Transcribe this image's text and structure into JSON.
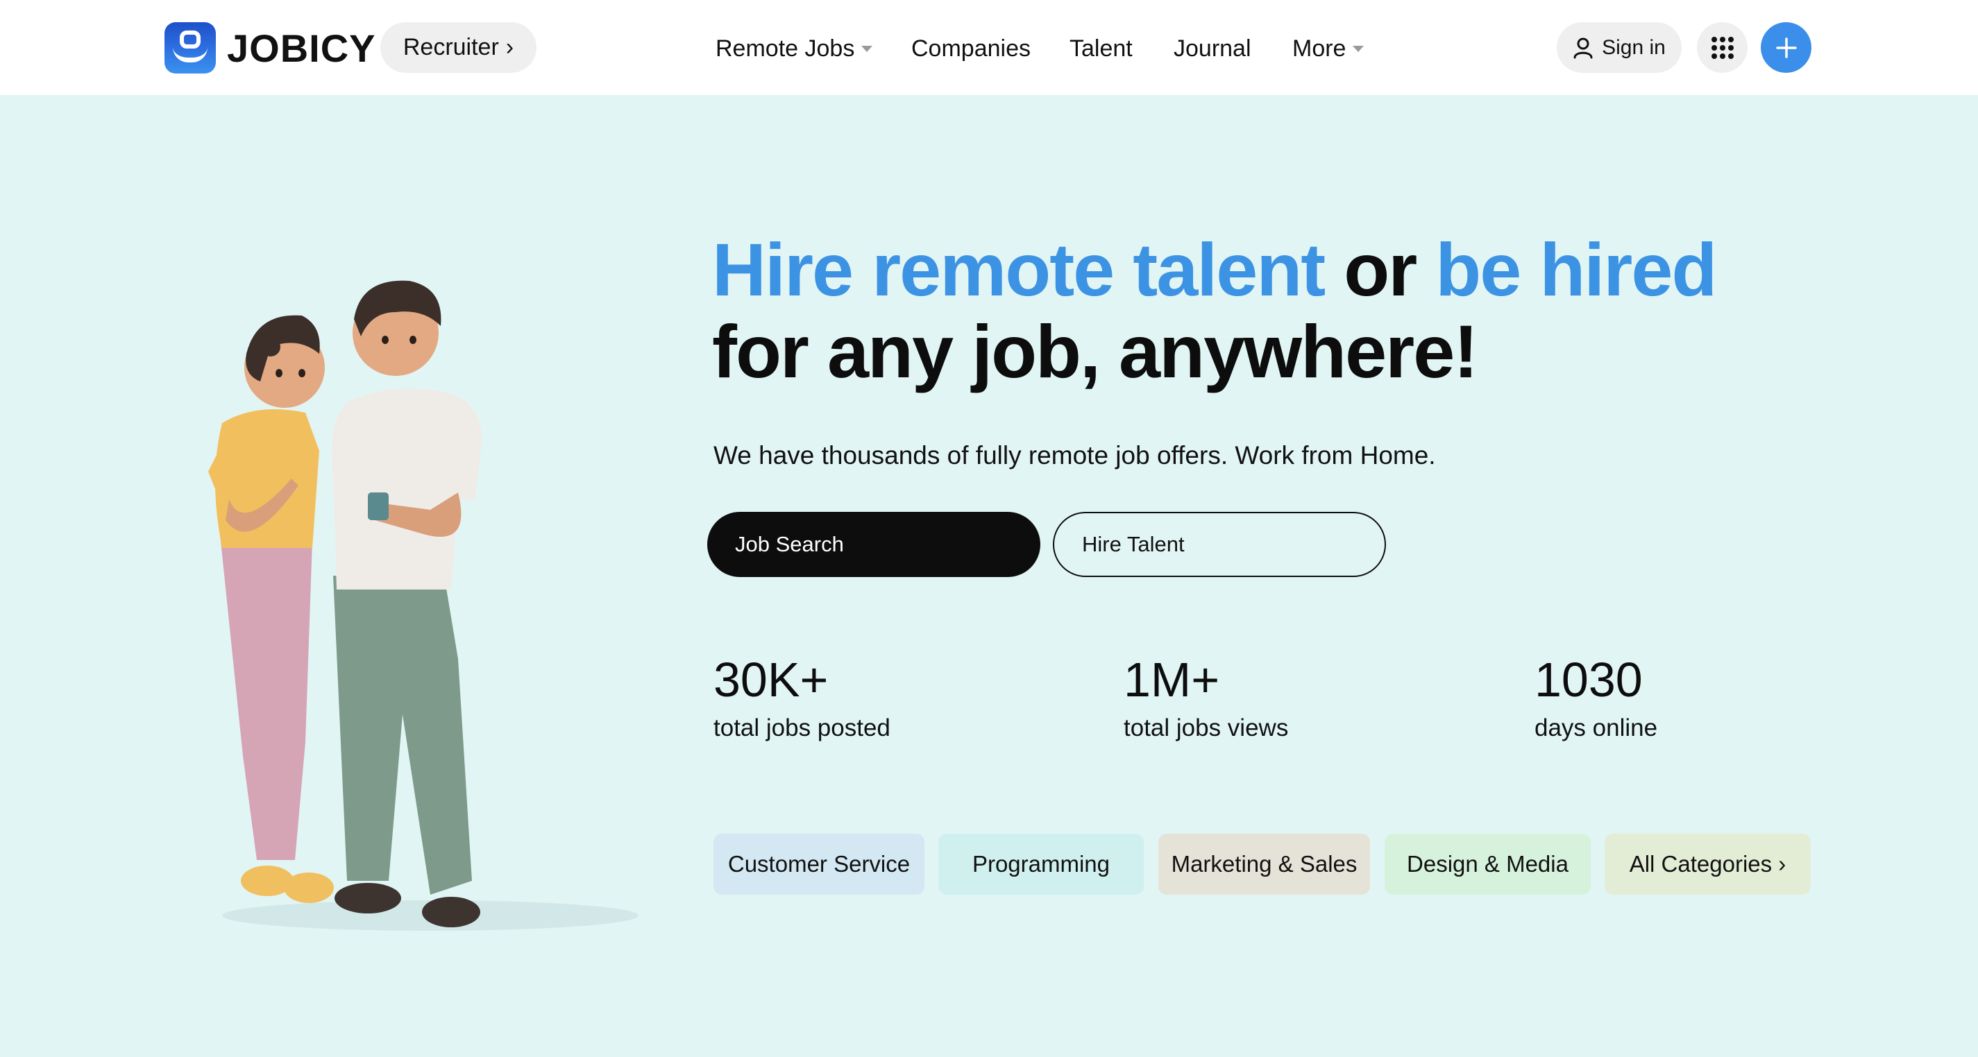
{
  "header": {
    "logo_text": "JOBICY",
    "recruiter_label": "Recruiter",
    "nav": [
      {
        "label": "Remote Jobs",
        "has_caret": true
      },
      {
        "label": "Companies",
        "has_caret": false
      },
      {
        "label": "Talent",
        "has_caret": false
      },
      {
        "label": "Journal",
        "has_caret": false
      },
      {
        "label": "More",
        "has_caret": true
      }
    ],
    "sign_in_label": "Sign in",
    "icons": {
      "apps": "grid-dots-icon",
      "add": "plus-icon",
      "user": "user-icon"
    }
  },
  "hero": {
    "headline_part1": "Hire remote talent",
    "headline_part2": " or ",
    "headline_part3": "be hired",
    "headline_line2": "for any job, anywhere!",
    "subtext": "We have thousands of fully remote job offers. Work from Home.",
    "primary_button": "Job Search",
    "secondary_button": "Hire Talent"
  },
  "stats": [
    {
      "value": "30K+",
      "label": "total jobs posted"
    },
    {
      "value": "1M+",
      "label": "total jobs views"
    },
    {
      "value": "1030",
      "label": "days online"
    }
  ],
  "categories": [
    {
      "label": "Customer Service",
      "color": "#d3e8f2"
    },
    {
      "label": "Programming",
      "color": "#d0f0f0"
    },
    {
      "label": "Marketing & Sales",
      "color": "#e5e2d8"
    },
    {
      "label": "Design & Media",
      "color": "#d6f2dc"
    },
    {
      "label": "All Categories ›",
      "color": "#e3edd6"
    }
  ],
  "colors": {
    "background": "#e2f5f5",
    "accent_blue": "#3d93e3",
    "plus_button": "#3b8eea",
    "dark": "#0d0d0d"
  }
}
